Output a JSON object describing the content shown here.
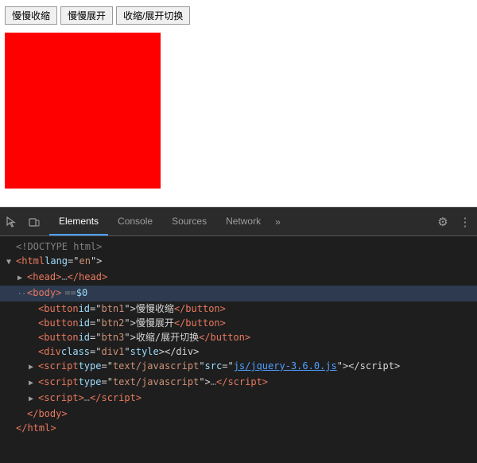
{
  "buttons": {
    "btn1": "慢慢收缩",
    "btn2": "慢慢展开",
    "btn3": "收缩/展开切换"
  },
  "devtools": {
    "tabs": [
      {
        "id": "elements",
        "label": "Elements",
        "active": true
      },
      {
        "id": "console",
        "label": "Console",
        "active": false
      },
      {
        "id": "sources",
        "label": "Sources",
        "active": false
      },
      {
        "id": "network",
        "label": "Network",
        "active": false
      }
    ]
  },
  "code": {
    "doctype": "<!DOCTYPE html>",
    "html_open": "<html lang=\"en\">",
    "head": "<head>…</head>",
    "body_open": "<body> == $0",
    "btn1_line": "<button id=\"btn1\">慢慢收缩</button>",
    "btn2_line": "<button id=\"btn2\">慢慢展开</button>",
    "btn3_line": "<button id=\"btn3\">收缩/展开切换</button>",
    "div_line": "<div class=\"div1\" style></div>",
    "script1_line": "<script type=\"text/javascript\" src=\"js/jquery-3.6.0.js\"></script>",
    "script2_line": "<script type=\"text/javascript\">…</script>",
    "script3_line": "<script>…</script>",
    "body_close": "</body>",
    "html_close": "</html>"
  }
}
